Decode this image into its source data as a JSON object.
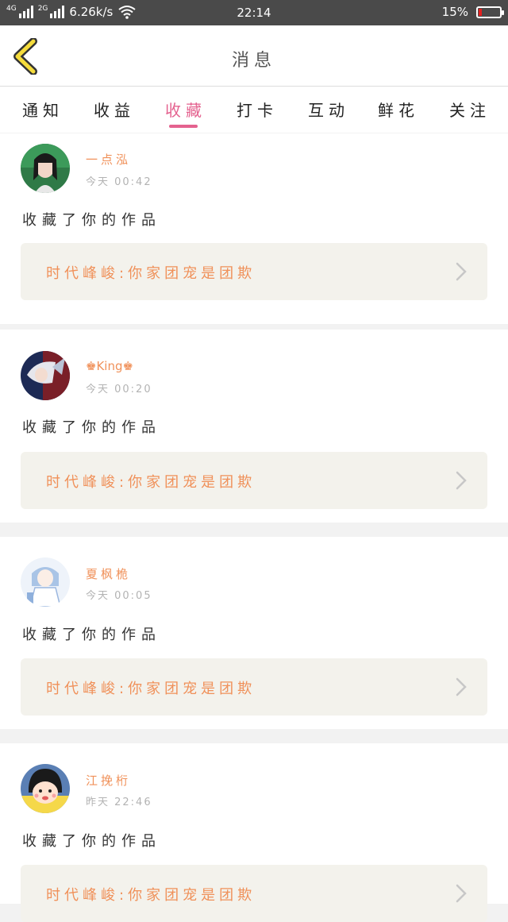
{
  "status_bar": {
    "network1": "4G",
    "network2": "2G",
    "speed": "6.26k/s",
    "time": "22:14",
    "battery_text": "15%",
    "battery_level": 0.15
  },
  "header": {
    "title": "消息"
  },
  "tabs": [
    {
      "label": "通知"
    },
    {
      "label": "收益"
    },
    {
      "label": "收藏",
      "active": true
    },
    {
      "label": "打卡"
    },
    {
      "label": "互动"
    },
    {
      "label": "鲜花"
    },
    {
      "label": "关注"
    }
  ],
  "messages": [
    {
      "user": "一点泓",
      "time": "今天 00:42",
      "action": "收藏了你的作品",
      "work": "时代峰峻:你家团宠是团欺"
    },
    {
      "user": "♚King♚",
      "time": "今天 00:20",
      "action": "收藏了你的作品",
      "work": "时代峰峻:你家团宠是团欺"
    },
    {
      "user": "夏枫桅",
      "time": "今天 00:05",
      "action": "收藏了你的作品",
      "work": "时代峰峻:你家团宠是团欺"
    },
    {
      "user": "江挽桁",
      "time": "昨天 22:46",
      "action": "收藏了你的作品",
      "work": "时代峰峻:你家团宠是团欺"
    }
  ],
  "colors": {
    "accent": "#e4628f",
    "name": "#f0915a",
    "back_arrow": "#f5dc3c"
  }
}
